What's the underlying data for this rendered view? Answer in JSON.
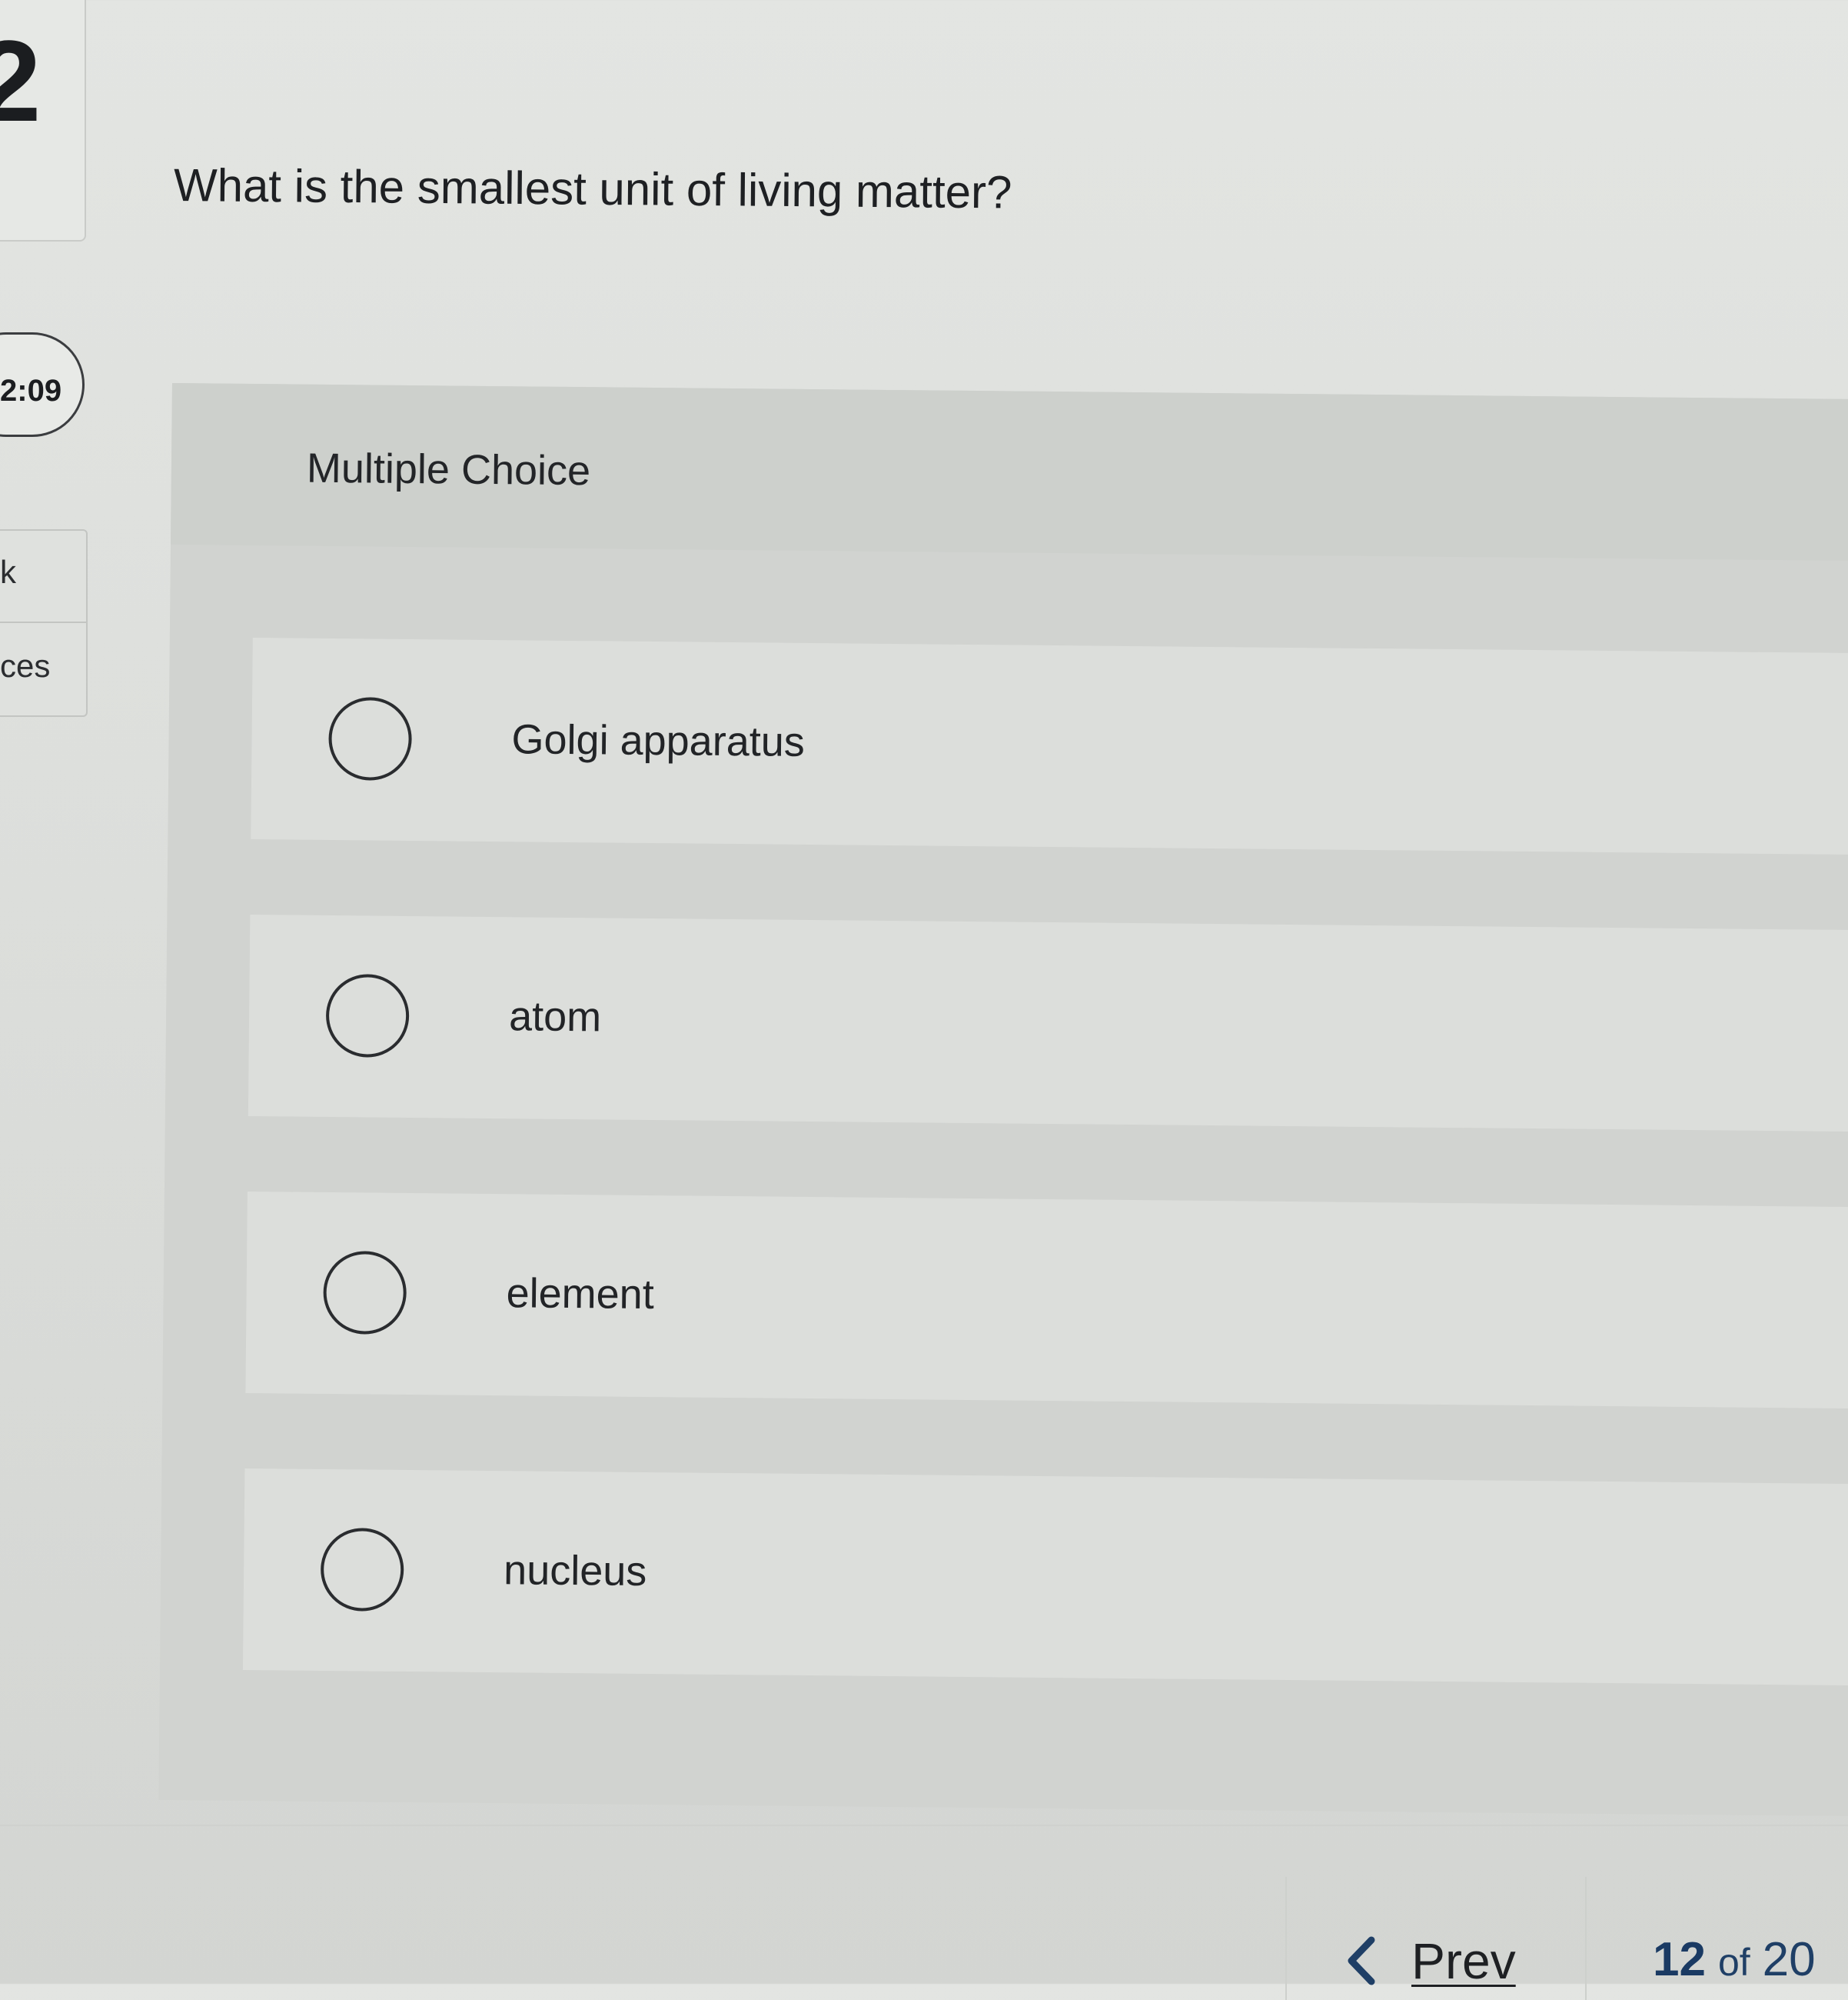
{
  "rail": {
    "question_number": "2",
    "timer": "2:09",
    "tab_1": "k",
    "tab_2": "ces"
  },
  "question": {
    "text": "What is the smallest unit of living matter?"
  },
  "panel": {
    "type_label": "Multiple Choice",
    "choices": [
      {
        "label": "Golgi apparatus"
      },
      {
        "label": "atom"
      },
      {
        "label": "element"
      },
      {
        "label": "nucleus"
      }
    ]
  },
  "nav": {
    "prev_label": "Prev",
    "current_page": "12",
    "of_label": "of",
    "total_pages": "20"
  }
}
